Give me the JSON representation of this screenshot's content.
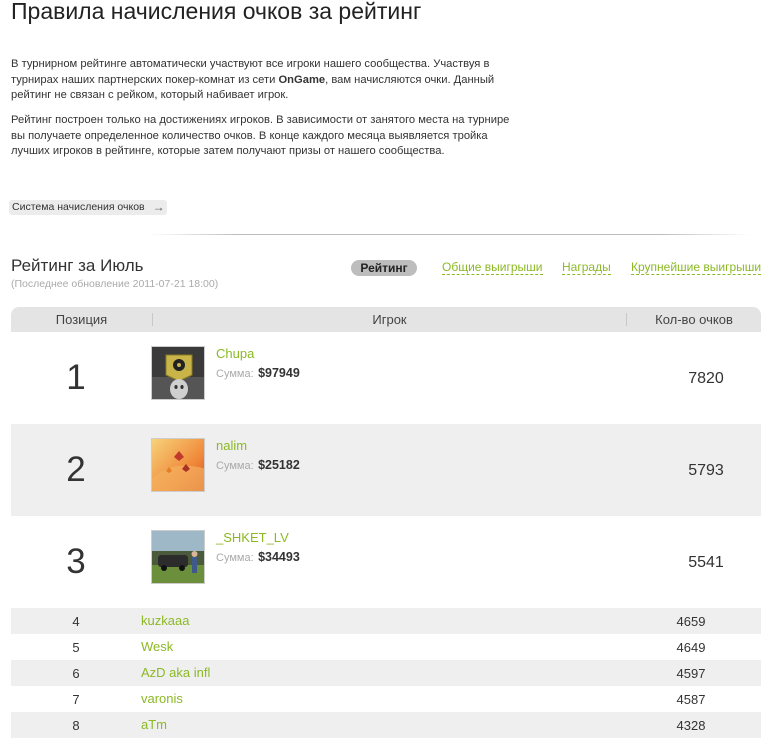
{
  "page_title": "Правила начисления очков за рейтинг",
  "intro": {
    "p1_before": "В турнирном рейтинге автоматически участвуют все игроки нашего сообщества. Участвуя в турнирах наших партнерских покер-комнат из сети ",
    "p1_strong": "OnGame",
    "p1_after": ", вам начисляются очки. Данный рейтинг не связан с рейком, который набивает игрок.",
    "p2": "Рейтинг построен только на достижениях игроков. В зависимости от занятого места на турнире вы получаете определенное количество очков. В конце каждого месяца выявляется тройка лучших игроков в рейтинге, которые затем получают призы от нашего сообщества."
  },
  "rules_link": {
    "label": "Система начисления очков",
    "icon": "arrow-right-icon",
    "arrow": "→"
  },
  "rating": {
    "title": "Рейтинг за Июль",
    "updated": "(Последнее обновление 2011-07-21 18:00)"
  },
  "tabs": [
    {
      "label": "Рейтинг",
      "active": true
    },
    {
      "label": "Общие выигрыши",
      "active": false
    },
    {
      "label": "Награды",
      "active": false
    },
    {
      "label": "Крупнейшие выигрыши",
      "active": false
    }
  ],
  "table": {
    "headers": {
      "position": "Позиция",
      "player": "Игрок",
      "points": "Кол-во очков"
    },
    "sum_label": "Сумма:",
    "top_rows": [
      {
        "rank": "1",
        "name": "Chupa",
        "sum": "$97949",
        "points": "7820",
        "avatar": "avatar-chupa"
      },
      {
        "rank": "2",
        "name": "nalim",
        "sum": "$25182",
        "points": "5793",
        "avatar": "avatar-nalim"
      },
      {
        "rank": "3",
        "name": "_SHKET_LV",
        "sum": "$34493",
        "points": "5541",
        "avatar": "avatar-shket"
      }
    ],
    "rows": [
      {
        "rank": "4",
        "name": "kuzkaaa",
        "points": "4659"
      },
      {
        "rank": "5",
        "name": "Wesk",
        "points": "4649"
      },
      {
        "rank": "6",
        "name": "AzD aka infl",
        "points": "4597"
      },
      {
        "rank": "7",
        "name": "varonis",
        "points": "4587"
      },
      {
        "rank": "8",
        "name": "aTm",
        "points": "4328"
      }
    ]
  },
  "colors": {
    "link": "#8cb925",
    "row_shade": "#efefef",
    "header_bg": "#e4e4e4",
    "active_tab": "#bdbdbd"
  }
}
